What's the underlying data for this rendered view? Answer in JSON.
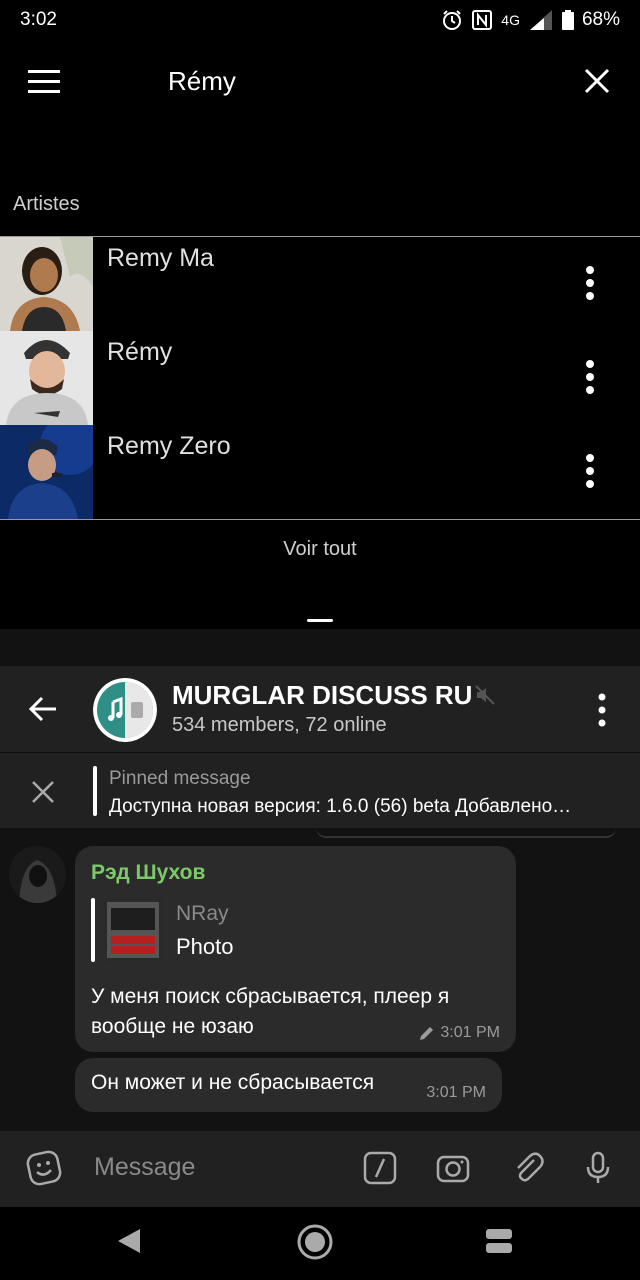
{
  "status_bar": {
    "time": "3:02",
    "network": "4G",
    "battery": "68%",
    "icons": [
      "alarm-icon",
      "nfc-icon",
      "signal-icon",
      "battery-icon"
    ]
  },
  "music_app": {
    "title": "Rémy",
    "section_label": "Artistes",
    "artists": [
      {
        "name": "Remy Ma"
      },
      {
        "name": "Rémy"
      },
      {
        "name": "Remy Zero"
      }
    ],
    "see_all": "Voir tout"
  },
  "telegram": {
    "group_name": "MURGLAR DISCUSS RU",
    "group_sub": "534 members, 72 online",
    "accent_color": "#2f8f86",
    "pinned": {
      "label": "Pinned message",
      "text": "Доступна новая версия: 1.6.0 (56) beta  Добавлено…"
    },
    "messages": [
      {
        "sender": "Рэд Шухов",
        "sender_color": "#7ec86c",
        "reply_to": {
          "name": "NRay",
          "text": "Photo"
        },
        "text": "У меня поиск сбрасывается, плеер я вообще не юзаю",
        "time": "3:01 PM",
        "edited": true
      },
      {
        "text": "Он может и не сбрасывается",
        "time": "3:01 PM"
      }
    ],
    "input_placeholder": "Message"
  }
}
